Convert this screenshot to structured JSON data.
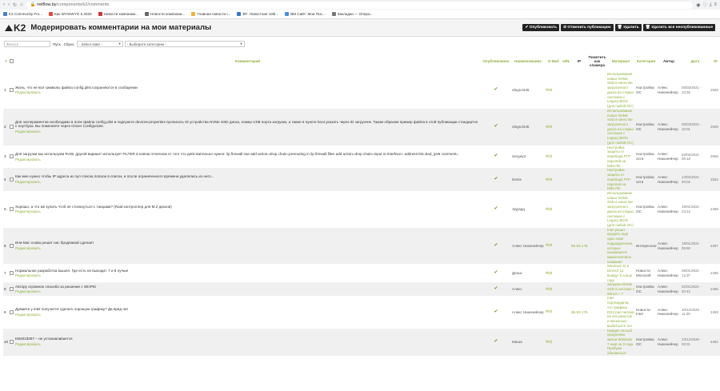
{
  "browser": {
    "host": "netflow.by",
    "path": "/components/k2/comments",
    "bookmarks": [
      "K2 Community Fro...",
      "Как WYSIWYG в 2020",
      "Новости компании...",
      "Новости компании...",
      "Главная новости I...",
      "ВТ: Новостная Jotb...",
      "ВМ Сайт: Мои Пос...",
      "Закладки — Опера..."
    ]
  },
  "header": {
    "logo": "K2",
    "title": "Модерировать комментарии на мои материалы",
    "buttons": [
      "✔ Опубликовать",
      "⊘ Отменить публикацию",
      "🗑 Удалить",
      "🗑 Удалить все неопубликованные"
    ]
  },
  "filters": {
    "filter_placeholder": "Фильтр",
    "go_label": "Пуск",
    "reset_label": "Сброс",
    "state_select": "- Select state -",
    "category_select": "- Выберите категорию -"
  },
  "columns": {
    "num": "#",
    "comment": "Комментарий",
    "published": "Опубликовано",
    "name": "Наименование",
    "email": "E-Mail",
    "url": "URL",
    "ip": "IP",
    "spam": "Пометить как спамера",
    "material": "Материал",
    "category": "Категория",
    "author": "Автор",
    "date": "Дата",
    "id": "ID"
  },
  "edit_label": "Редактировать",
  "rows": [
    {
      "num": "1",
      "comment": "Жаль, что не все символы файла config.plist сохраняются в сообщении",
      "name": "oleg12345",
      "url": "",
      "ip": "",
      "material": "Использование новых NVMe SSD в качестве загрузочного диска на старых системах с Legacy BIOS (для любой ОС)",
      "category": "Настройка ОС",
      "author": "Алекс Никонейчер",
      "date": "05/03/2021 - 10:35",
      "id": "2509"
    },
    {
      "num": "2",
      "comment": "Для экспериментов необходимо в поле файла config.plist в подпункте devices-properties прописать ID устройства NVMe SSD диска, номер USB порта загрузки, а также в пункте boot указать через ID загрузчик. Таким образом пример файла в этой публикации стандартно с ноутбука. Вы поменяете через Clover Configurator.",
      "name": "oleg12345",
      "url": "",
      "ip": "",
      "material": "Использование новых NVMe SSD в качестве загрузочного диска на старых системах с Legacy BIOS (для любой ОС)",
      "category": "Настройка ОС",
      "author": "Алекс Никонейчер",
      "date": "05/03/2021 - 10:01",
      "id": "2508"
    },
    {
      "num": "3",
      "comment": "Для загрузки мы используем RAW, другой вариант использует FILTER в новом отличном от того что действительно нужно: /ip firewall raw add action=drop chain=prerouting in /ip firewall filter add action=drop chain=input in-interface= address-list=bad_ipv6 comment=",
      "name": "Sergey3",
      "url": "",
      "ip": "",
      "material": "Настройка защиты от перебора FTP паролей на MikroTik",
      "category": "Настройка сети",
      "author": "Алекс Никонейчер",
      "date": "02/02/2021 - 00:18",
      "id": "2506"
    },
    {
      "num": "4",
      "comment": "Как мне нужно чтобы IP адреса из пул списка попали в список, и после ограниченного времени удалялись из него...",
      "name": "Denis",
      "url": "",
      "ip": "",
      "material": "Настройка защиты от перебора FTP паролей на MikroTik",
      "category": "Настройка сети",
      "author": "Алекс Никонейчер",
      "date": "14/02/2021 - 00:02",
      "id": "2503"
    },
    {
      "num": "5",
      "comment": "Хорошо, а что же купить чтоб не столкнуться с танцами? (Raid контроллер для M.2 дисков)",
      "name": "Эдуард",
      "url": "",
      "ip": "",
      "material": "Использование новых NVMe SSD в качестве загрузочного диска на старых системах с Legacy BIOS (для любой ОС)",
      "category": "Настройка ОС",
      "author": "Алекс Никонейчер",
      "date": "19/01/2021 - 23:12",
      "id": "2498"
    },
    {
      "num": "6",
      "comment": "Или Mac снова решит нас бродяжкой сделает",
      "name": "Алекс Никонейчер",
      "url": "",
      "ip": "85.93.175.15",
      "material": "Intel решит продать ещё одно своё подразделение, которые называются маркетинговое название",
      "category": "Интересное",
      "author": "Алекс Никонейчер",
      "date": "18/01/2021 - 09:50",
      "id": "2497"
    },
    {
      "num": "7",
      "comment": "Нормальное разработка вышел. Где есть не выходит. 7 и 8 лучше",
      "name": "Денис",
      "url": "",
      "ip": "",
      "material": "Windows 11 и DirectX 12 выйдут в конце года",
      "category": "Новости Microsoft",
      "author": "Алекс Никонейчер",
      "date": "06/01/2021 - 12:37",
      "id": "2496"
    },
    {
      "num": "8",
      "comment": "Автору огромное спасибо за решение с WinPE!",
      "name": "Алекс",
      "url": "",
      "ip": "",
      "material": "Загрузка NVMe SSD в системе с Win10 + 7",
      "category": "Настройка ОС",
      "author": "Алекс Никонейчер",
      "date": "02/01/2021 - 20:43",
      "id": "2495"
    },
    {
      "num": "9",
      "comment": "Думаете у intel получится сделать хорошую графику? Да вряд ли!",
      "name": "Алекс Никонейчер",
      "url": "",
      "ip": "85.93.175.15",
      "material": "Intel подтвердила, что графика DG2 рассчитана на энтузиастов и насколько выбиться в топ",
      "category": "Новости Intel",
      "author": "Алекс Никонейчер",
      "date": "20/12/2020 - 11:38",
      "id": "2493"
    },
    {
      "num": "10",
      "comment": "KB4023057 – не устанавливается",
      "name": "Маша",
      "url": "",
      "ip": "",
      "material": "Найден способ продления жизни Windows 7 ещё на 3 года. Пробуем обновиться",
      "category": "Настройка ОС",
      "author": "Алекс Никонейчер",
      "date": "23/12/2020 - 03:31",
      "id": "2492"
    }
  ]
}
